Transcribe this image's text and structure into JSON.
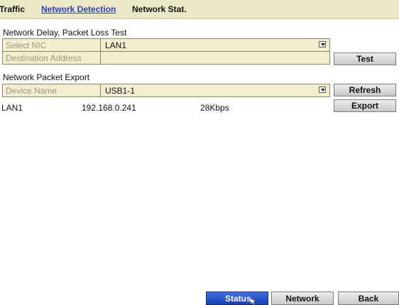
{
  "tabs": [
    {
      "label": "Traffic"
    },
    {
      "label": "Network Detection"
    },
    {
      "label": "Network Stat."
    }
  ],
  "delay_test": {
    "title": "Network Delay, Packet Loss Test",
    "select_nic": {
      "label": "Select NIC",
      "value": "LAN1"
    },
    "destination": {
      "label": "Destination Address",
      "value": ""
    },
    "test_button": "Test"
  },
  "packet_export": {
    "title": "Network Packet Export",
    "device": {
      "label": "Device Name",
      "value": "USB1-1"
    },
    "refresh_button": "Refresh",
    "export_button": "Export",
    "row": {
      "interface": "LAN1",
      "ip": "192.168.0.241",
      "rate": "28Kbps"
    }
  },
  "bottom": {
    "status_button": "Status",
    "network_button": "Network",
    "back_button": "Back"
  },
  "colors": {
    "accent": "#2a3fbf",
    "panel": "#ece7c6",
    "primary_button": "#1c3fae"
  }
}
